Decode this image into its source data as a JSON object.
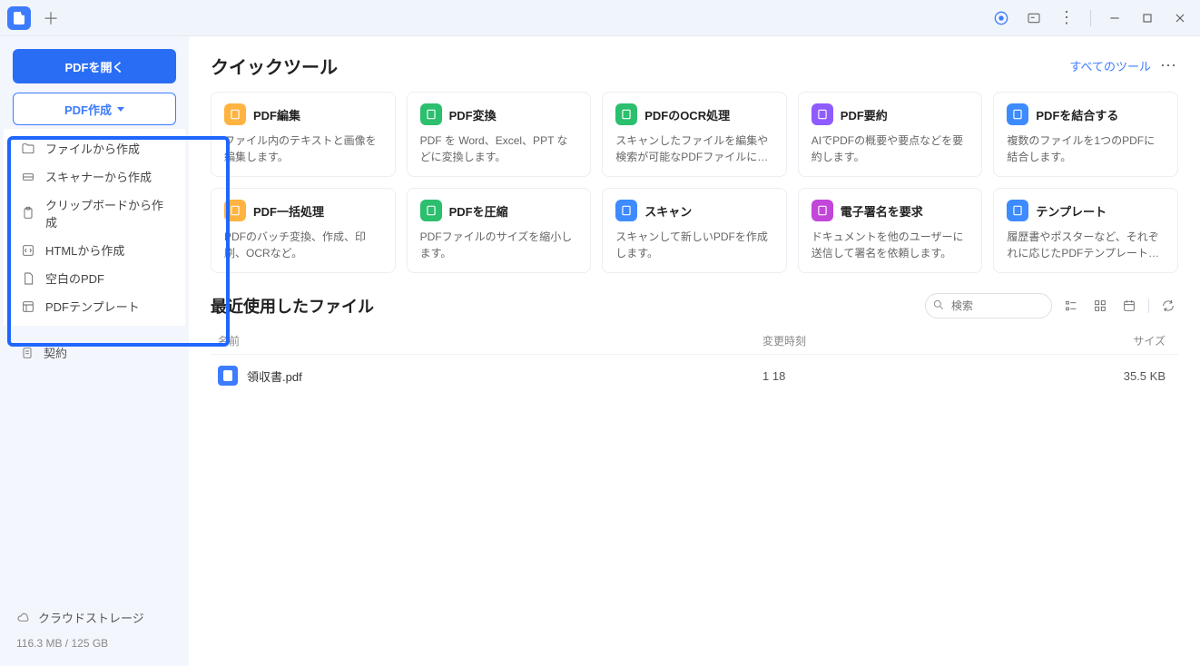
{
  "titlebar": {
    "new_tab": "＋"
  },
  "sidebar": {
    "open_label": "PDFを開く",
    "create_label": "PDF作成",
    "dropdown": [
      "ファイルから作成",
      "スキャナーから作成",
      "クリップボードから作成",
      "HTMLから作成",
      "空白のPDF",
      "PDFテンプレート"
    ],
    "contract_label": "契約",
    "cloud_label": "クラウドストレージ",
    "storage_text": "116.3 MB / 125 GB"
  },
  "quick": {
    "title": "クイックツール",
    "all_tools": "すべてのツール",
    "tools": [
      {
        "title": "PDF編集",
        "desc": "ファイル内のテキストと画像を編集します。",
        "bg": "#ffb341"
      },
      {
        "title": "PDF変換",
        "desc": "PDF を Word、Excel、PPT などに変換します。",
        "bg": "#2bbf6e"
      },
      {
        "title": "PDFのOCR処理",
        "desc": "スキャンしたファイルを編集や検索が可能なPDFファイルに変換...",
        "bg": "#2bbf6e"
      },
      {
        "title": "PDF要約",
        "desc": "AIでPDFの概要や要点などを要約します。",
        "bg": "#8f5bff"
      },
      {
        "title": "PDFを結合する",
        "desc": "複数のファイルを1つのPDFに結合します。",
        "bg": "#3d8bff"
      },
      {
        "title": "PDF一括処理",
        "desc": "PDFのバッチ変換、作成、印刷、OCRなど。",
        "bg": "#ffb341"
      },
      {
        "title": "PDFを圧縮",
        "desc": "PDFファイルのサイズを縮小します。",
        "bg": "#2bbf6e"
      },
      {
        "title": "スキャン",
        "desc": "スキャンして新しいPDFを作成します。",
        "bg": "#3d8bff"
      },
      {
        "title": "電子署名を要求",
        "desc": "ドキュメントを他のユーザーに送信して署名を依頼します。",
        "bg": "#c246d9"
      },
      {
        "title": "テンプレート",
        "desc": "履歴書やポスターなど、それぞれに応じたPDFテンプレートを入...",
        "bg": "#3d8bff"
      }
    ]
  },
  "recent": {
    "title": "最近使用したファイル",
    "search_placeholder": "検索",
    "columns": {
      "name": "名前",
      "modified": "変更時刻",
      "size": "サイズ"
    },
    "files": [
      {
        "name": "領収書.pdf",
        "modified": "1 18",
        "size": "35.5 KB"
      }
    ]
  }
}
